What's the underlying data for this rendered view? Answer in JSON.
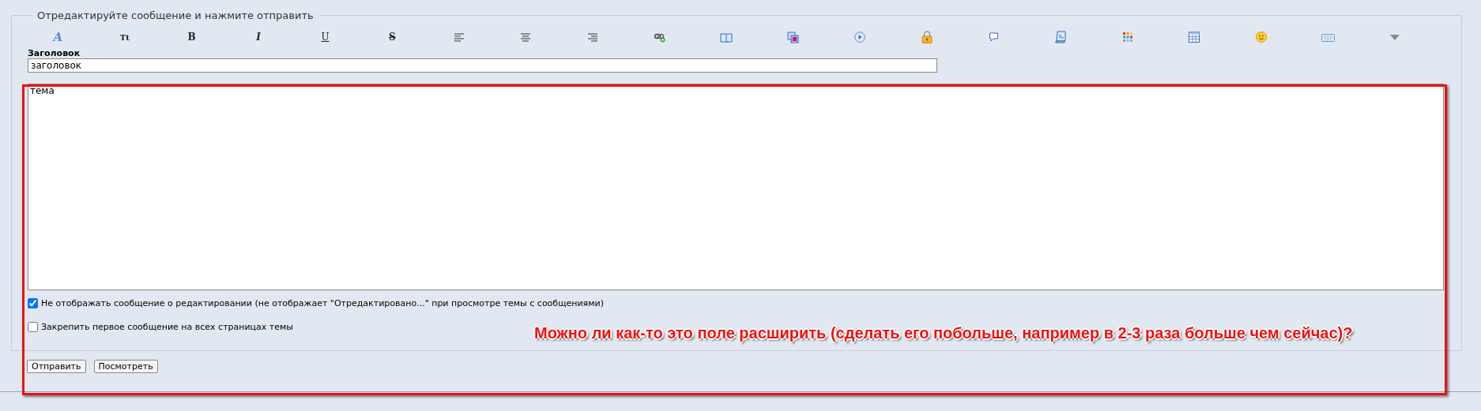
{
  "form": {
    "legend": "Отредактируйте сообщение и нажмите отправить",
    "toolbar": [
      {
        "kind": "font",
        "label": "A"
      },
      {
        "kind": "size",
        "label": "Tt"
      },
      {
        "kind": "bold",
        "label": "B"
      },
      {
        "kind": "italic",
        "label": "I"
      },
      {
        "kind": "underline",
        "label": "U"
      },
      {
        "kind": "strike",
        "label": "S"
      },
      {
        "kind": "align-left"
      },
      {
        "kind": "align-center"
      },
      {
        "kind": "align-right"
      },
      {
        "kind": "link"
      },
      {
        "kind": "book"
      },
      {
        "kind": "copy"
      },
      {
        "kind": "play"
      },
      {
        "kind": "lock"
      },
      {
        "kind": "bubble"
      },
      {
        "kind": "scroll"
      },
      {
        "kind": "palette"
      },
      {
        "kind": "table"
      },
      {
        "kind": "smiley"
      },
      {
        "kind": "keyboard"
      },
      {
        "kind": "more"
      }
    ],
    "title_label": "Заголовок",
    "title_value": "заголовок",
    "message_value": "тема",
    "options": [
      {
        "label": "Не отображать сообщение о редактировании (не отображает \"Отредактировано...\" при просмотре темы с сообщениями)",
        "checked": true
      },
      {
        "label": "Закрепить первое сообщение на всех страницах темы",
        "checked": false
      }
    ]
  },
  "buttons": [
    "Отправить",
    "Посмотреть"
  ],
  "annotation": "Можно ли как-то это поле расширить (сделать его побольше, например в 2-3 раза больше чем сейчас)?"
}
